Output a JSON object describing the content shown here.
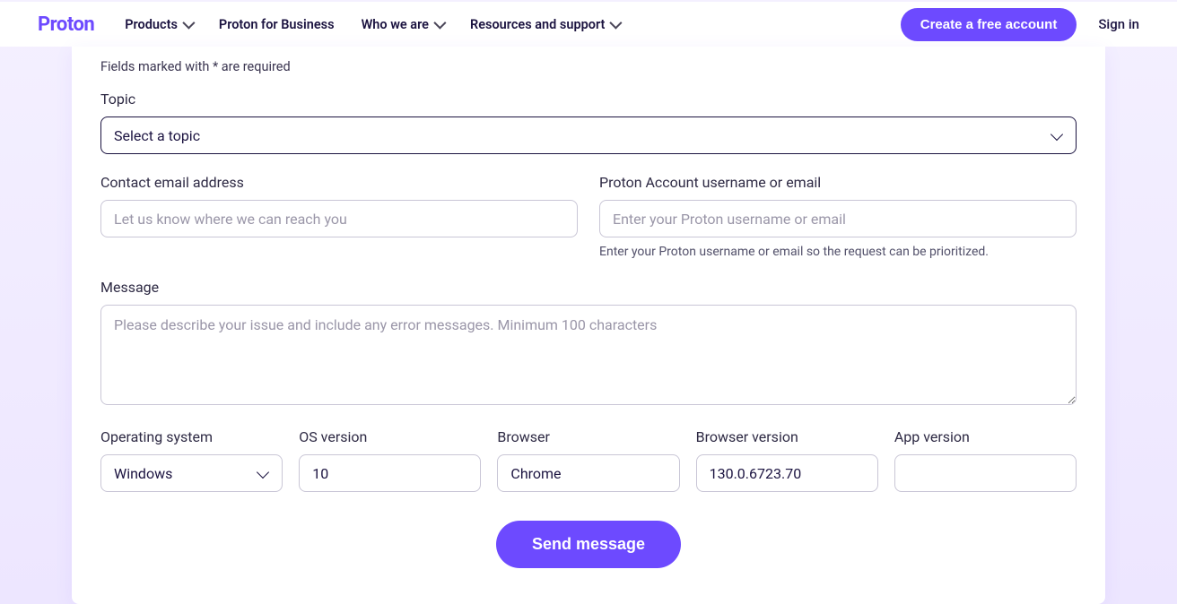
{
  "header": {
    "logo_text": "Proton",
    "nav": {
      "products": "Products",
      "business": "Proton for Business",
      "who": "Who we are",
      "resources": "Resources and support"
    },
    "cta": "Create a free account",
    "signin": "Sign in"
  },
  "form": {
    "required_note": "Fields marked with * are required",
    "topic": {
      "label": "Topic",
      "placeholder": "Select a topic"
    },
    "contact": {
      "label": "Contact email address",
      "placeholder": "Let us know where we can reach you"
    },
    "account": {
      "label": "Proton Account username or email",
      "placeholder": "Enter your Proton username or email",
      "helper": "Enter your Proton username or email so the request can be prioritized."
    },
    "message": {
      "label": "Message",
      "placeholder": "Please describe your issue and include any error messages. Minimum 100 characters"
    },
    "os": {
      "label": "Operating system",
      "value": "Windows"
    },
    "os_version": {
      "label": "OS version",
      "value": "10"
    },
    "browser": {
      "label": "Browser",
      "value": "Chrome"
    },
    "browser_version": {
      "label": "Browser version",
      "value": "130.0.6723.70"
    },
    "app_version": {
      "label": "App version",
      "value": ""
    },
    "submit": "Send message"
  }
}
